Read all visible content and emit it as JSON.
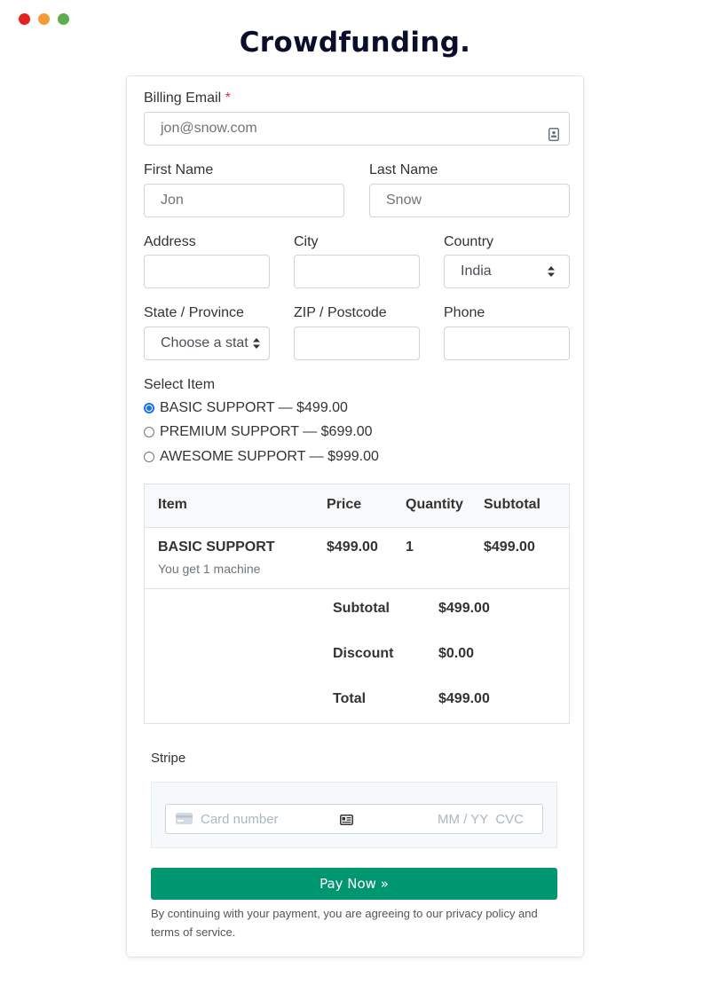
{
  "window": {
    "controls": [
      {
        "name": "close",
        "color": "#e5211d"
      },
      {
        "name": "minimize",
        "color": "#f59a38"
      },
      {
        "name": "maximize",
        "color": "#5fae4e"
      }
    ]
  },
  "page_title": "Crowdfunding.",
  "form": {
    "billing_email": {
      "label": "Billing Email",
      "required_mark": "*",
      "placeholder": "jon@snow.com",
      "icon": "contact-card-icon"
    },
    "first_name": {
      "label": "First Name",
      "placeholder": "Jon"
    },
    "last_name": {
      "label": "Last Name",
      "placeholder": "Snow"
    },
    "address": {
      "label": "Address",
      "value": ""
    },
    "city": {
      "label": "City",
      "value": ""
    },
    "country": {
      "label": "Country",
      "selected": "India"
    },
    "state": {
      "label": "State / Province",
      "selected": "Choose a stat"
    },
    "zip": {
      "label": "ZIP / Postcode",
      "value": ""
    },
    "phone": {
      "label": "Phone",
      "value": ""
    },
    "select_item": {
      "label": "Select Item",
      "options": [
        {
          "label": "BASIC SUPPORT — $499.00",
          "checked": true
        },
        {
          "label": "PREMIUM SUPPORT — $699.00",
          "checked": false
        },
        {
          "label": "AWESOME SUPPORT — $999.00",
          "checked": false
        }
      ]
    }
  },
  "order_table": {
    "headers": [
      "Item",
      "Price",
      "Quantity",
      "Subtotal"
    ],
    "rows": [
      {
        "item": "BASIC SUPPORT",
        "description": "You get 1 machine",
        "price": "$499.00",
        "quantity": "1",
        "subtotal": "$499.00"
      }
    ],
    "summary": [
      {
        "label": "Subtotal",
        "value": "$499.00"
      },
      {
        "label": "Discount",
        "value": "$0.00"
      },
      {
        "label": "Total",
        "value": "$499.00"
      }
    ]
  },
  "payment": {
    "method_label": "Stripe",
    "card_number_placeholder": "Card number",
    "expiry_cvc_placeholder": "MM / YY  CVC",
    "pay_button": "Pay Now »",
    "button_color": "#009670",
    "terms": "By continuing with your payment, you are agreeing to our privacy policy and terms of service."
  }
}
